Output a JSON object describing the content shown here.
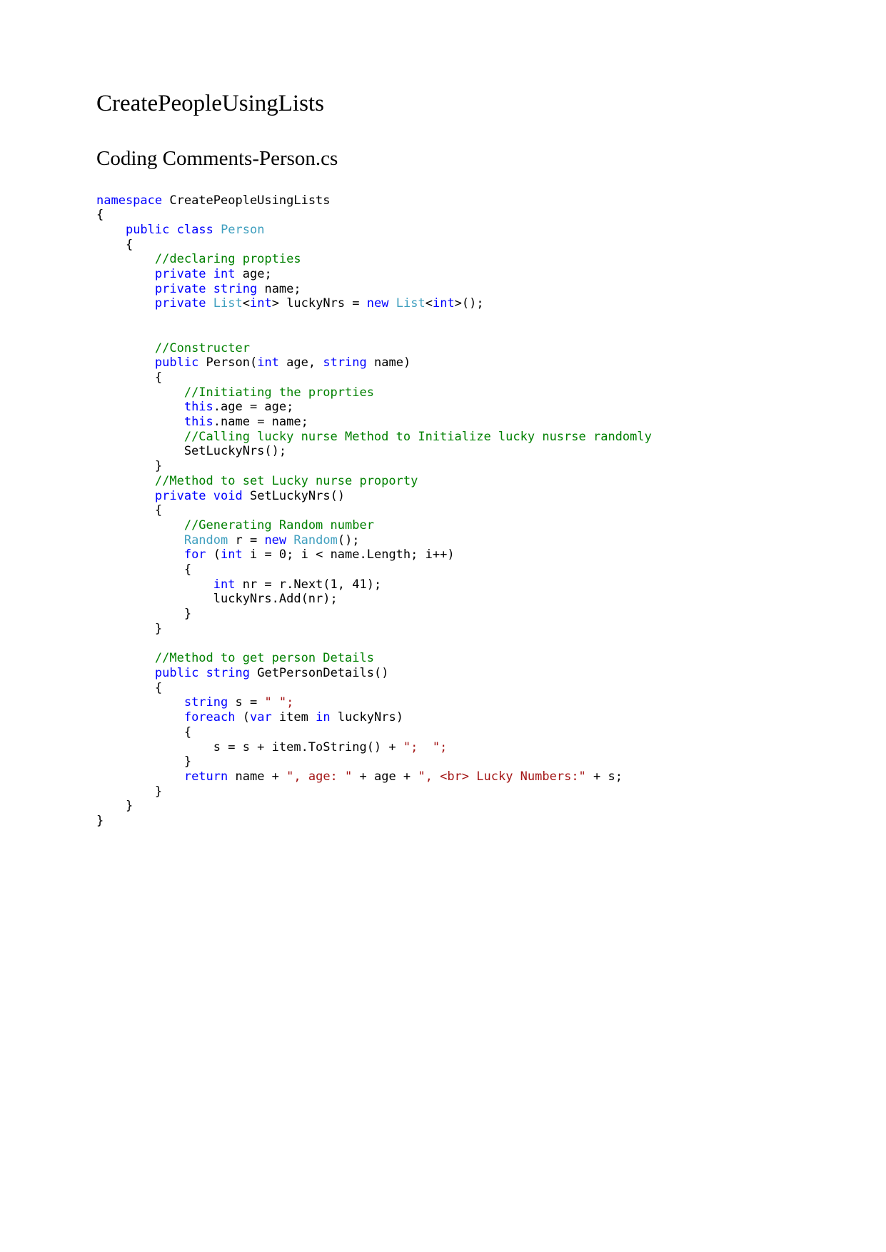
{
  "document": {
    "title": "CreatePeopleUsingLists",
    "subtitle": "Coding Comments-Person.cs"
  },
  "colors": {
    "keyword": "#0000ff",
    "type": "#3f9fbf",
    "comment": "#008000",
    "string": "#a31515",
    "plain": "#000000",
    "background": "#ffffff"
  },
  "code": {
    "language": "csharp",
    "filename": "Person.cs",
    "lines": [
      [
        {
          "t": "namespace",
          "c": "kw"
        },
        {
          "t": " CreatePeopleUsingLists",
          "c": "pln"
        }
      ],
      [
        {
          "t": "{",
          "c": "pln"
        }
      ],
      [
        {
          "t": "    ",
          "c": "pln"
        },
        {
          "t": "public",
          "c": "kw"
        },
        {
          "t": " ",
          "c": "pln"
        },
        {
          "t": "class",
          "c": "kw"
        },
        {
          "t": " ",
          "c": "pln"
        },
        {
          "t": "Person",
          "c": "typ"
        }
      ],
      [
        {
          "t": "    {",
          "c": "pln"
        }
      ],
      [
        {
          "t": "        ",
          "c": "pln"
        },
        {
          "t": "//declaring propties",
          "c": "cmt"
        }
      ],
      [
        {
          "t": "        ",
          "c": "pln"
        },
        {
          "t": "private",
          "c": "kw"
        },
        {
          "t": " ",
          "c": "pln"
        },
        {
          "t": "int",
          "c": "kw"
        },
        {
          "t": " age;",
          "c": "pln"
        }
      ],
      [
        {
          "t": "        ",
          "c": "pln"
        },
        {
          "t": "private",
          "c": "kw"
        },
        {
          "t": " ",
          "c": "pln"
        },
        {
          "t": "string",
          "c": "kw"
        },
        {
          "t": " name;",
          "c": "pln"
        }
      ],
      [
        {
          "t": "        ",
          "c": "pln"
        },
        {
          "t": "private",
          "c": "kw"
        },
        {
          "t": " ",
          "c": "pln"
        },
        {
          "t": "List",
          "c": "typ"
        },
        {
          "t": "<",
          "c": "pln"
        },
        {
          "t": "int",
          "c": "kw"
        },
        {
          "t": "> luckyNrs = ",
          "c": "pln"
        },
        {
          "t": "new",
          "c": "kw"
        },
        {
          "t": " ",
          "c": "pln"
        },
        {
          "t": "List",
          "c": "typ"
        },
        {
          "t": "<",
          "c": "pln"
        },
        {
          "t": "int",
          "c": "kw"
        },
        {
          "t": ">();",
          "c": "pln"
        }
      ],
      [],
      [],
      [
        {
          "t": "        ",
          "c": "pln"
        },
        {
          "t": "//Constructer",
          "c": "cmt"
        }
      ],
      [
        {
          "t": "        ",
          "c": "pln"
        },
        {
          "t": "public",
          "c": "kw"
        },
        {
          "t": " Person(",
          "c": "pln"
        },
        {
          "t": "int",
          "c": "kw"
        },
        {
          "t": " age, ",
          "c": "pln"
        },
        {
          "t": "string",
          "c": "kw"
        },
        {
          "t": " name)",
          "c": "pln"
        }
      ],
      [
        {
          "t": "        {",
          "c": "pln"
        }
      ],
      [
        {
          "t": "            ",
          "c": "pln"
        },
        {
          "t": "//Initiating the proprties",
          "c": "cmt"
        }
      ],
      [
        {
          "t": "            ",
          "c": "pln"
        },
        {
          "t": "this",
          "c": "kw"
        },
        {
          "t": ".age = age;",
          "c": "pln"
        }
      ],
      [
        {
          "t": "            ",
          "c": "pln"
        },
        {
          "t": "this",
          "c": "kw"
        },
        {
          "t": ".name = name;",
          "c": "pln"
        }
      ],
      [
        {
          "t": "            ",
          "c": "pln"
        },
        {
          "t": "//Calling lucky nurse Method to Initialize lucky nusrse randomly",
          "c": "cmt"
        }
      ],
      [
        {
          "t": "            SetLuckyNrs();",
          "c": "pln"
        }
      ],
      [
        {
          "t": "        }",
          "c": "pln"
        }
      ],
      [
        {
          "t": "        ",
          "c": "pln"
        },
        {
          "t": "//Method to set Lucky nurse proporty",
          "c": "cmt"
        }
      ],
      [
        {
          "t": "        ",
          "c": "pln"
        },
        {
          "t": "private",
          "c": "kw"
        },
        {
          "t": " ",
          "c": "pln"
        },
        {
          "t": "void",
          "c": "kw"
        },
        {
          "t": " SetLuckyNrs()",
          "c": "pln"
        }
      ],
      [
        {
          "t": "        {",
          "c": "pln"
        }
      ],
      [
        {
          "t": "            ",
          "c": "pln"
        },
        {
          "t": "//Generating Random number",
          "c": "cmt"
        }
      ],
      [
        {
          "t": "            ",
          "c": "pln"
        },
        {
          "t": "Random",
          "c": "typ"
        },
        {
          "t": " r = ",
          "c": "pln"
        },
        {
          "t": "new",
          "c": "kw"
        },
        {
          "t": " ",
          "c": "pln"
        },
        {
          "t": "Random",
          "c": "typ"
        },
        {
          "t": "();",
          "c": "pln"
        }
      ],
      [
        {
          "t": "            ",
          "c": "pln"
        },
        {
          "t": "for",
          "c": "kw"
        },
        {
          "t": " (",
          "c": "pln"
        },
        {
          "t": "int",
          "c": "kw"
        },
        {
          "t": " i = 0; i < name.Length; i++)",
          "c": "pln"
        }
      ],
      [
        {
          "t": "            {",
          "c": "pln"
        }
      ],
      [
        {
          "t": "                ",
          "c": "pln"
        },
        {
          "t": "int",
          "c": "kw"
        },
        {
          "t": " nr = r.Next(1, 41);",
          "c": "pln"
        }
      ],
      [
        {
          "t": "                luckyNrs.Add(nr);",
          "c": "pln"
        }
      ],
      [
        {
          "t": "            }",
          "c": "pln"
        }
      ],
      [
        {
          "t": "        }",
          "c": "pln"
        }
      ],
      [],
      [
        {
          "t": "        ",
          "c": "pln"
        },
        {
          "t": "//Method to get person Details",
          "c": "cmt"
        }
      ],
      [
        {
          "t": "        ",
          "c": "pln"
        },
        {
          "t": "public",
          "c": "kw"
        },
        {
          "t": " ",
          "c": "pln"
        },
        {
          "t": "string",
          "c": "kw"
        },
        {
          "t": " GetPersonDetails()",
          "c": "pln"
        }
      ],
      [
        {
          "t": "        {",
          "c": "pln"
        }
      ],
      [
        {
          "t": "            ",
          "c": "pln"
        },
        {
          "t": "string",
          "c": "kw"
        },
        {
          "t": " s = ",
          "c": "pln"
        },
        {
          "t": "\" \";",
          "c": "str"
        }
      ],
      [
        {
          "t": "            ",
          "c": "pln"
        },
        {
          "t": "foreach",
          "c": "kw"
        },
        {
          "t": " (",
          "c": "pln"
        },
        {
          "t": "var",
          "c": "kw"
        },
        {
          "t": " item ",
          "c": "pln"
        },
        {
          "t": "in",
          "c": "kw"
        },
        {
          "t": " luckyNrs)",
          "c": "pln"
        }
      ],
      [
        {
          "t": "            {",
          "c": "pln"
        }
      ],
      [
        {
          "t": "                s = s + item.ToString() + ",
          "c": "pln"
        },
        {
          "t": "\";  \";",
          "c": "str"
        }
      ],
      [
        {
          "t": "            }",
          "c": "pln"
        }
      ],
      [
        {
          "t": "            ",
          "c": "pln"
        },
        {
          "t": "return",
          "c": "kw"
        },
        {
          "t": " name + ",
          "c": "pln"
        },
        {
          "t": "\", age: \"",
          "c": "str"
        },
        {
          "t": " + age + ",
          "c": "pln"
        },
        {
          "t": "\", <br> Lucky Numbers:\"",
          "c": "str"
        },
        {
          "t": " + s;",
          "c": "pln"
        }
      ],
      [
        {
          "t": "        }",
          "c": "pln"
        }
      ],
      [
        {
          "t": "    }",
          "c": "pln"
        }
      ],
      [
        {
          "t": "}",
          "c": "pln"
        }
      ]
    ]
  }
}
